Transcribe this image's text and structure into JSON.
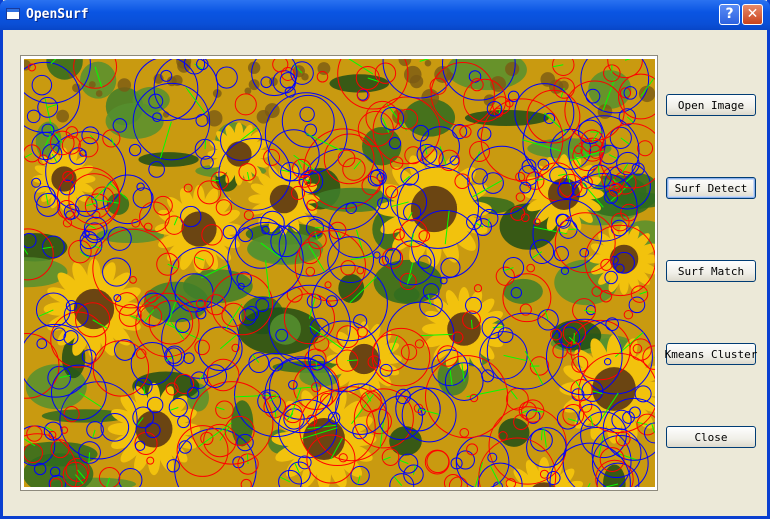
{
  "window": {
    "title": "OpenSurf"
  },
  "titlebar_buttons": {
    "help": "?",
    "close": "✕"
  },
  "buttons": [
    {
      "label": "Open Image"
    },
    {
      "label": "Surf Detect",
      "focused": true
    },
    {
      "label": "Surf Match"
    },
    {
      "label": "Kmeans Cluster"
    },
    {
      "label": "Close"
    }
  ],
  "image": {
    "content": "sunflower field with SURF keypoint circles",
    "colors": {
      "keypoint_light": "#ff0000",
      "keypoint_dark": "#0000ff",
      "orientation": "#00ff00"
    }
  }
}
